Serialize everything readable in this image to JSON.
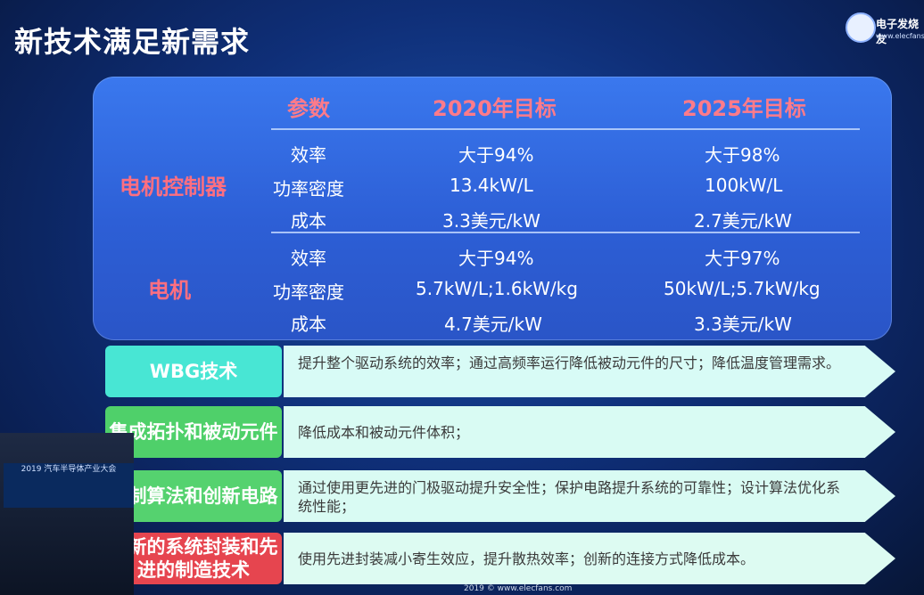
{
  "slide": {
    "title": "新技术满足新需求",
    "logo_text": "电子发烧友",
    "logo_url": "www.elecfans.com",
    "footer": "2019 © www.elecfans.com",
    "podium_text": "2019 汽车半导体产业大会"
  },
  "table": {
    "headers": [
      "参数",
      "2020年目标",
      "2025年目标"
    ],
    "groups": [
      {
        "name": "电机控制器",
        "rows": [
          {
            "param": "效率",
            "y2020": "大于94%",
            "y2025": "大于98%"
          },
          {
            "param": "功率密度",
            "y2020": "13.4kW/L",
            "y2025": "100kW/L"
          },
          {
            "param": "成本",
            "y2020": "3.3美元/kW",
            "y2025": "2.7美元/kW"
          }
        ]
      },
      {
        "name": "电机",
        "rows": [
          {
            "param": "效率",
            "y2020": "大于94%",
            "y2025": "大于97%"
          },
          {
            "param": "功率密度",
            "y2020": "5.7kW/L;1.6kW/kg",
            "y2025": "50kW/L;5.7kW/kg"
          },
          {
            "param": "成本",
            "y2020": "4.7美元/kW",
            "y2025": "3.3美元/kW"
          }
        ]
      }
    ]
  },
  "techs": [
    {
      "label": "WBG技术",
      "desc": "提升整个驱动系统的效率；通过高频率运行降低被动元件的尺寸；降低温度管理需求。",
      "color": "#48e6d4"
    },
    {
      "label": "集成拓扑和被动元件",
      "desc": "降低成本和被动元件体积；",
      "color": "#4fd06a"
    },
    {
      "label": "控制算法和创新电路",
      "desc": "通过使用更先进的门极驱动提升安全性；保护电路提升系统的可靠性；设计算法优化系统性能；",
      "color": "#55d26f"
    },
    {
      "label": "创新的系统封装和先进的制造技术",
      "desc": "使用先进封装减小寄生效应，提升散热效率；创新的连接方式降低成本。",
      "color": "#e6454f"
    }
  ]
}
